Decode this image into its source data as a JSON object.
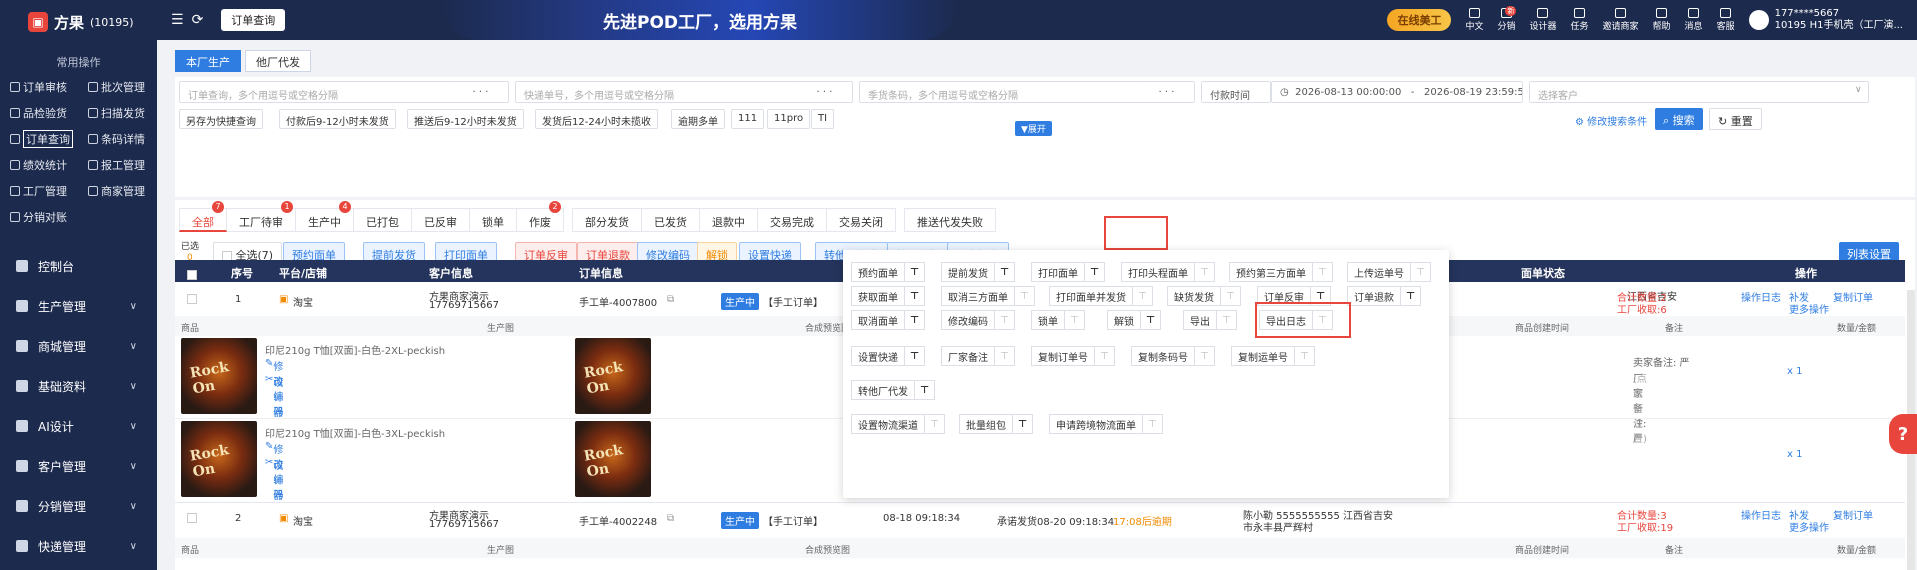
{
  "sidebar": {
    "brand": "方果",
    "brand_id": "(10195)",
    "common_title": "常用操作",
    "quick": [
      "订单审核",
      "批次管理",
      "品检验货",
      "扫描发货",
      "订单查询",
      "条码详情",
      "绩效统计",
      "报工管理",
      "工厂管理",
      "商家管理",
      "分销对账"
    ],
    "menu": [
      "控制台",
      "生产管理",
      "商城管理",
      "基础资料",
      "AI设计",
      "客户管理",
      "分销管理",
      "快递管理"
    ]
  },
  "topbar": {
    "tab": "订单查询",
    "banner": "先进POD工厂，选用方果",
    "online": "在线美工",
    "icons": [
      {
        "label": "中文",
        "icon": "translate-icon"
      },
      {
        "label": "分销",
        "icon": "distribution-icon",
        "badge": "新"
      },
      {
        "label": "设计器",
        "icon": "designer-icon"
      },
      {
        "label": "任务",
        "icon": "task-icon"
      },
      {
        "label": "邀请商家",
        "icon": "invite-icon"
      },
      {
        "label": "帮助",
        "icon": "help-icon"
      },
      {
        "label": "消息",
        "icon": "message-icon"
      },
      {
        "label": "客服",
        "icon": "service-icon"
      }
    ],
    "user_phone": "177****5667",
    "user_info": "10195 H1手机壳（工厂演..."
  },
  "source_tabs": [
    "本厂生产",
    "他厂代发"
  ],
  "filters": {
    "order_ph": "订单查询，多个用逗号或空格分隔",
    "express_ph": "快递单号，多个用逗号或空格分隔",
    "sku_ph": "季货条码，多个用逗号或空格分隔",
    "dots": "· · ·",
    "time_type": "付款时间",
    "date_from": "2026-08-13 00:00:00",
    "date_sep": "-",
    "date_to": "2026-08-19 23:59:59",
    "customer_ph": "选择客户",
    "chips": [
      "另存为快捷查询",
      "付款后9-12小时未发货",
      "推送后9-12小时未发货",
      "发货后12-24小时未揽收",
      "逾期多单",
      "111",
      "11pro",
      "TI"
    ],
    "expand": "▼展开",
    "modify": "修改搜索条件",
    "search": "搜索",
    "reset": "重置"
  },
  "status_tabs": [
    {
      "label": "全部",
      "badge": "7"
    },
    {
      "label": "工厂待审",
      "badge": "1"
    },
    {
      "label": "生产中",
      "badge": "4"
    },
    {
      "label": "已打包",
      "badge": ""
    },
    {
      "label": "已反审",
      "badge": ""
    },
    {
      "label": "锁单",
      "badge": ""
    },
    {
      "label": "作废",
      "badge": "2"
    },
    {
      "label": "部分发货",
      "badge": ""
    },
    {
      "label": "已发货",
      "badge": ""
    },
    {
      "label": "退款中",
      "badge": ""
    },
    {
      "label": "交易完成",
      "badge": ""
    },
    {
      "label": "交易关闭",
      "badge": ""
    },
    {
      "label": "推送代发失败",
      "badge": ""
    }
  ],
  "actions": {
    "selected_label": "已选",
    "selected_count": "0",
    "select_all": "全选(7)",
    "buttons": [
      "预约面单",
      "提前发货",
      "打印面单",
      "订单反审",
      "订单退款",
      "修改编码",
      "解锁",
      "设置快递",
      "转他厂代发",
      "批量组包",
      "更多操作"
    ],
    "list_settings": "列表设置"
  },
  "table": {
    "headers": [
      "序号",
      "平台/店铺",
      "客户信息",
      "订单信息",
      "面单状态",
      "操作"
    ],
    "sub_headers": [
      "商品",
      "生产图",
      "合成预览图",
      "商品创建时间",
      "备注",
      "数量/金额"
    ],
    "orders": [
      {
        "seq": "1",
        "platform": "淘宝",
        "customer": "方果商家演示",
        "phone": "17769715667",
        "order_no": "手工单-4007800",
        "status": "生产中",
        "tag": "【手工订单】",
        "addr": "江西省吉安",
        "total": "合计数量:2",
        "fee": "工厂收取:6",
        "ops": [
          "操作日志",
          "补发",
          "复制订单",
          "更多操作"
        ],
        "items": [
          {
            "name": "印尼210g T恤[双面]-白色-2XL-peckish",
            "edit": "修改编码",
            "designer": "设计器",
            "qty": "x 1"
          },
          {
            "name": "印尼210g T恤[双面]-白色-3XL-peckish",
            "edit": "修改编码",
            "designer": "设计器",
            "qty": "x 1"
          }
        ],
        "remark_seller": "卖家备注: 严",
        "remark_factory": "厂家备注: 严",
        "remark_hint": "(点击可设置)"
      },
      {
        "seq": "2",
        "platform": "淘宝",
        "customer": "方果商家演示",
        "phone": "17769715667",
        "order_no": "手工单-4002248",
        "status": "生产中",
        "tag": "【手工订单】",
        "time": "08-18 09:18:34",
        "promise": "承诺发货08-20 09:18:34",
        "overdue": "17:08后逾期",
        "addr": "陈小勒 5555555555 江西省吉安",
        "addr2": "市永丰县严辉村",
        "total": "合计数量:3",
        "fee": "工厂收取:19",
        "ops": [
          "操作日志",
          "补发",
          "复制订单",
          "更多操作"
        ]
      }
    ]
  },
  "dropdown": {
    "rows": [
      [
        {
          "l": "预约面单",
          "p": true
        },
        {
          "l": "提前发货",
          "p": true
        },
        {
          "l": "打印面单",
          "p": true
        },
        {
          "l": "打印头程面单",
          "p": false
        },
        {
          "l": "预约第三方面单",
          "p": false
        },
        {
          "l": "上传运单号",
          "p": false
        }
      ],
      [
        {
          "l": "获取面单",
          "p": true
        },
        {
          "l": "取消三方面单",
          "p": false
        },
        {
          "l": "打印面单并发货",
          "p": false
        },
        {
          "l": "缺货发货",
          "p": false
        },
        {
          "l": "订单反审",
          "p": true
        },
        {
          "l": "订单退款",
          "p": true
        }
      ],
      [
        {
          "l": "取消面单",
          "p": true
        },
        {
          "l": "修改编码",
          "p": false
        },
        {
          "l": "锁单",
          "p": false
        },
        {
          "l": "解锁",
          "p": true
        },
        {
          "l": "导出",
          "p": false
        },
        {
          "l": "导出日志",
          "p": false
        }
      ],
      [
        {
          "l": "设置快递",
          "p": true
        },
        {
          "l": "厂家备注",
          "p": false
        },
        {
          "l": "复制订单号",
          "p": false
        },
        {
          "l": "复制条码号",
          "p": false
        },
        {
          "l": "复制运单号",
          "p": false
        }
      ],
      [
        {
          "l": "转他厂代发",
          "p": true
        }
      ],
      [
        {
          "l": "设置物流渠道",
          "p": false
        },
        {
          "l": "批量组包",
          "p": true
        },
        {
          "l": "申请跨境物流面单",
          "p": false
        }
      ]
    ]
  },
  "colors": {
    "nav": "#1c2a4d",
    "accent": "#2f7de1",
    "danger": "#e8453c",
    "warning": "#f08a00"
  }
}
